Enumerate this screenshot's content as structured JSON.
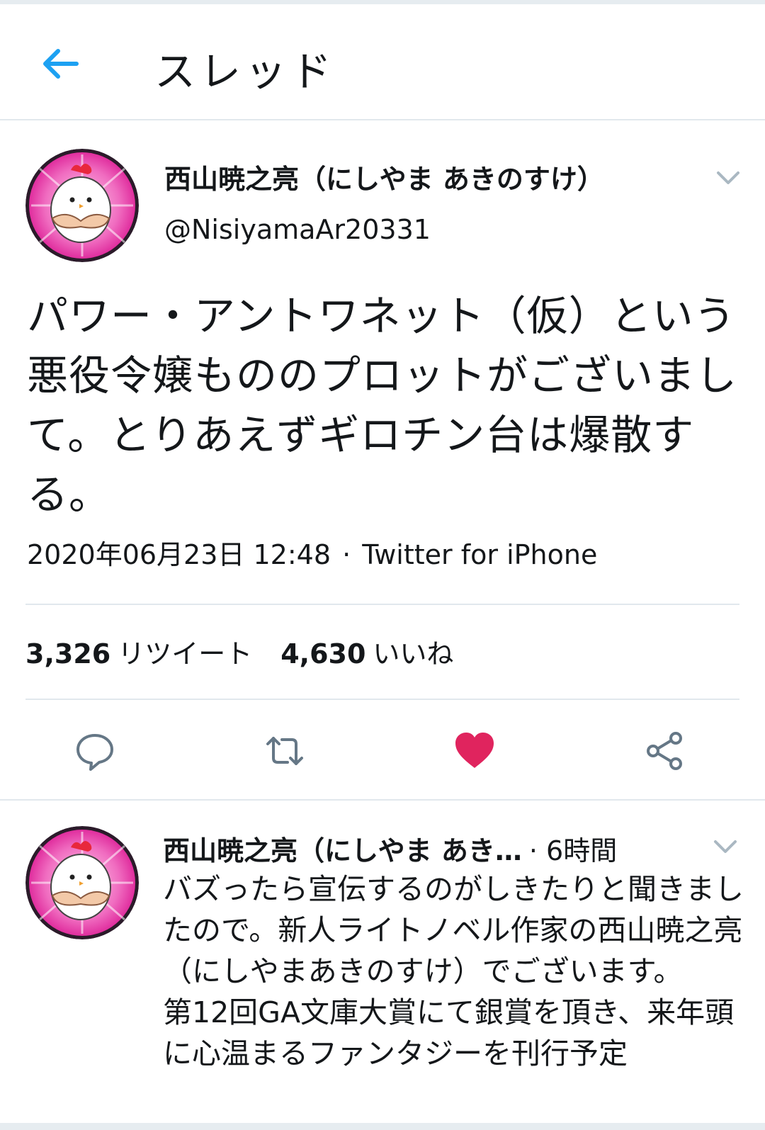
{
  "header": {
    "title": "スレッド",
    "back_icon": "arrow-left-icon"
  },
  "colors": {
    "accent": "#1da1f2",
    "like": "#e0245e",
    "text": "#14171a",
    "icon_gray": "#657786",
    "divider": "#e1e8ed"
  },
  "tweet": {
    "author_name": "西山暁之亮（にしやま あきのすけ）",
    "handle": "@NisiyamaAr20331",
    "text": "パワー・アントワネット（仮）という悪役令嬢もののプロットがございまして。とりあえずギロチン台は爆散する。",
    "datetime": "2020年06月23日 12:48",
    "separator": "·",
    "source": "Twitter for iPhone",
    "retweet_count": "3,326",
    "retweet_label": "リツイート",
    "like_count": "4,630",
    "like_label": "いいね",
    "liked": true
  },
  "reply": {
    "author_name": "西山暁之亮（にしやま あき…",
    "time": "· 6時間",
    "text_paragraphs": [
      "バズったら宣伝するのがしきたりと聞きましたので。新人ライトノベル作家の西山暁之亮（にしやまあきのすけ）でございます。",
      "第12回GA文庫大賞にて銀賞を頂き、来年頭に心温まるファンタジーを刊行予定"
    ]
  }
}
